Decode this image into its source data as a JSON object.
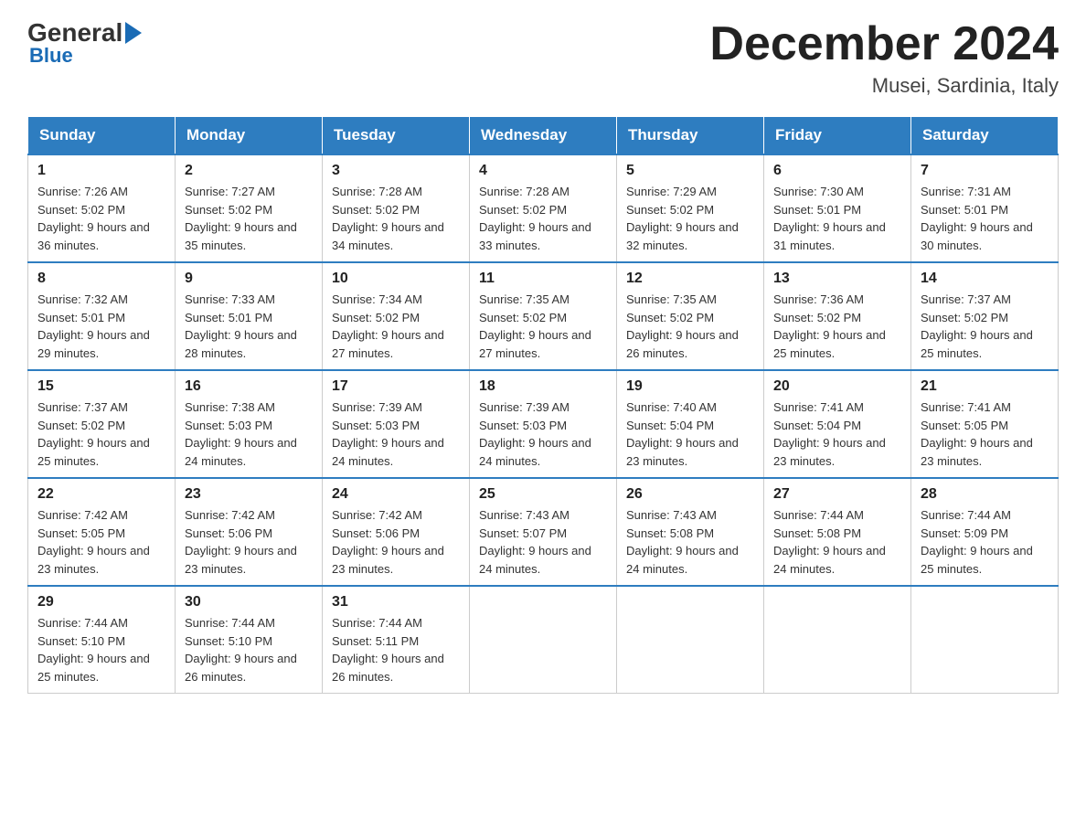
{
  "header": {
    "logo": {
      "general": "General",
      "blue": "Blue"
    },
    "title": "December 2024",
    "location": "Musei, Sardinia, Italy"
  },
  "days_of_week": [
    "Sunday",
    "Monday",
    "Tuesday",
    "Wednesday",
    "Thursday",
    "Friday",
    "Saturday"
  ],
  "weeks": [
    [
      {
        "day": "1",
        "sunrise": "Sunrise: 7:26 AM",
        "sunset": "Sunset: 5:02 PM",
        "daylight": "Daylight: 9 hours and 36 minutes."
      },
      {
        "day": "2",
        "sunrise": "Sunrise: 7:27 AM",
        "sunset": "Sunset: 5:02 PM",
        "daylight": "Daylight: 9 hours and 35 minutes."
      },
      {
        "day": "3",
        "sunrise": "Sunrise: 7:28 AM",
        "sunset": "Sunset: 5:02 PM",
        "daylight": "Daylight: 9 hours and 34 minutes."
      },
      {
        "day": "4",
        "sunrise": "Sunrise: 7:28 AM",
        "sunset": "Sunset: 5:02 PM",
        "daylight": "Daylight: 9 hours and 33 minutes."
      },
      {
        "day": "5",
        "sunrise": "Sunrise: 7:29 AM",
        "sunset": "Sunset: 5:02 PM",
        "daylight": "Daylight: 9 hours and 32 minutes."
      },
      {
        "day": "6",
        "sunrise": "Sunrise: 7:30 AM",
        "sunset": "Sunset: 5:01 PM",
        "daylight": "Daylight: 9 hours and 31 minutes."
      },
      {
        "day": "7",
        "sunrise": "Sunrise: 7:31 AM",
        "sunset": "Sunset: 5:01 PM",
        "daylight": "Daylight: 9 hours and 30 minutes."
      }
    ],
    [
      {
        "day": "8",
        "sunrise": "Sunrise: 7:32 AM",
        "sunset": "Sunset: 5:01 PM",
        "daylight": "Daylight: 9 hours and 29 minutes."
      },
      {
        "day": "9",
        "sunrise": "Sunrise: 7:33 AM",
        "sunset": "Sunset: 5:01 PM",
        "daylight": "Daylight: 9 hours and 28 minutes."
      },
      {
        "day": "10",
        "sunrise": "Sunrise: 7:34 AM",
        "sunset": "Sunset: 5:02 PM",
        "daylight": "Daylight: 9 hours and 27 minutes."
      },
      {
        "day": "11",
        "sunrise": "Sunrise: 7:35 AM",
        "sunset": "Sunset: 5:02 PM",
        "daylight": "Daylight: 9 hours and 27 minutes."
      },
      {
        "day": "12",
        "sunrise": "Sunrise: 7:35 AM",
        "sunset": "Sunset: 5:02 PM",
        "daylight": "Daylight: 9 hours and 26 minutes."
      },
      {
        "day": "13",
        "sunrise": "Sunrise: 7:36 AM",
        "sunset": "Sunset: 5:02 PM",
        "daylight": "Daylight: 9 hours and 25 minutes."
      },
      {
        "day": "14",
        "sunrise": "Sunrise: 7:37 AM",
        "sunset": "Sunset: 5:02 PM",
        "daylight": "Daylight: 9 hours and 25 minutes."
      }
    ],
    [
      {
        "day": "15",
        "sunrise": "Sunrise: 7:37 AM",
        "sunset": "Sunset: 5:02 PM",
        "daylight": "Daylight: 9 hours and 25 minutes."
      },
      {
        "day": "16",
        "sunrise": "Sunrise: 7:38 AM",
        "sunset": "Sunset: 5:03 PM",
        "daylight": "Daylight: 9 hours and 24 minutes."
      },
      {
        "day": "17",
        "sunrise": "Sunrise: 7:39 AM",
        "sunset": "Sunset: 5:03 PM",
        "daylight": "Daylight: 9 hours and 24 minutes."
      },
      {
        "day": "18",
        "sunrise": "Sunrise: 7:39 AM",
        "sunset": "Sunset: 5:03 PM",
        "daylight": "Daylight: 9 hours and 24 minutes."
      },
      {
        "day": "19",
        "sunrise": "Sunrise: 7:40 AM",
        "sunset": "Sunset: 5:04 PM",
        "daylight": "Daylight: 9 hours and 23 minutes."
      },
      {
        "day": "20",
        "sunrise": "Sunrise: 7:41 AM",
        "sunset": "Sunset: 5:04 PM",
        "daylight": "Daylight: 9 hours and 23 minutes."
      },
      {
        "day": "21",
        "sunrise": "Sunrise: 7:41 AM",
        "sunset": "Sunset: 5:05 PM",
        "daylight": "Daylight: 9 hours and 23 minutes."
      }
    ],
    [
      {
        "day": "22",
        "sunrise": "Sunrise: 7:42 AM",
        "sunset": "Sunset: 5:05 PM",
        "daylight": "Daylight: 9 hours and 23 minutes."
      },
      {
        "day": "23",
        "sunrise": "Sunrise: 7:42 AM",
        "sunset": "Sunset: 5:06 PM",
        "daylight": "Daylight: 9 hours and 23 minutes."
      },
      {
        "day": "24",
        "sunrise": "Sunrise: 7:42 AM",
        "sunset": "Sunset: 5:06 PM",
        "daylight": "Daylight: 9 hours and 23 minutes."
      },
      {
        "day": "25",
        "sunrise": "Sunrise: 7:43 AM",
        "sunset": "Sunset: 5:07 PM",
        "daylight": "Daylight: 9 hours and 24 minutes."
      },
      {
        "day": "26",
        "sunrise": "Sunrise: 7:43 AM",
        "sunset": "Sunset: 5:08 PM",
        "daylight": "Daylight: 9 hours and 24 minutes."
      },
      {
        "day": "27",
        "sunrise": "Sunrise: 7:44 AM",
        "sunset": "Sunset: 5:08 PM",
        "daylight": "Daylight: 9 hours and 24 minutes."
      },
      {
        "day": "28",
        "sunrise": "Sunrise: 7:44 AM",
        "sunset": "Sunset: 5:09 PM",
        "daylight": "Daylight: 9 hours and 25 minutes."
      }
    ],
    [
      {
        "day": "29",
        "sunrise": "Sunrise: 7:44 AM",
        "sunset": "Sunset: 5:10 PM",
        "daylight": "Daylight: 9 hours and 25 minutes."
      },
      {
        "day": "30",
        "sunrise": "Sunrise: 7:44 AM",
        "sunset": "Sunset: 5:10 PM",
        "daylight": "Daylight: 9 hours and 26 minutes."
      },
      {
        "day": "31",
        "sunrise": "Sunrise: 7:44 AM",
        "sunset": "Sunset: 5:11 PM",
        "daylight": "Daylight: 9 hours and 26 minutes."
      },
      null,
      null,
      null,
      null
    ]
  ]
}
